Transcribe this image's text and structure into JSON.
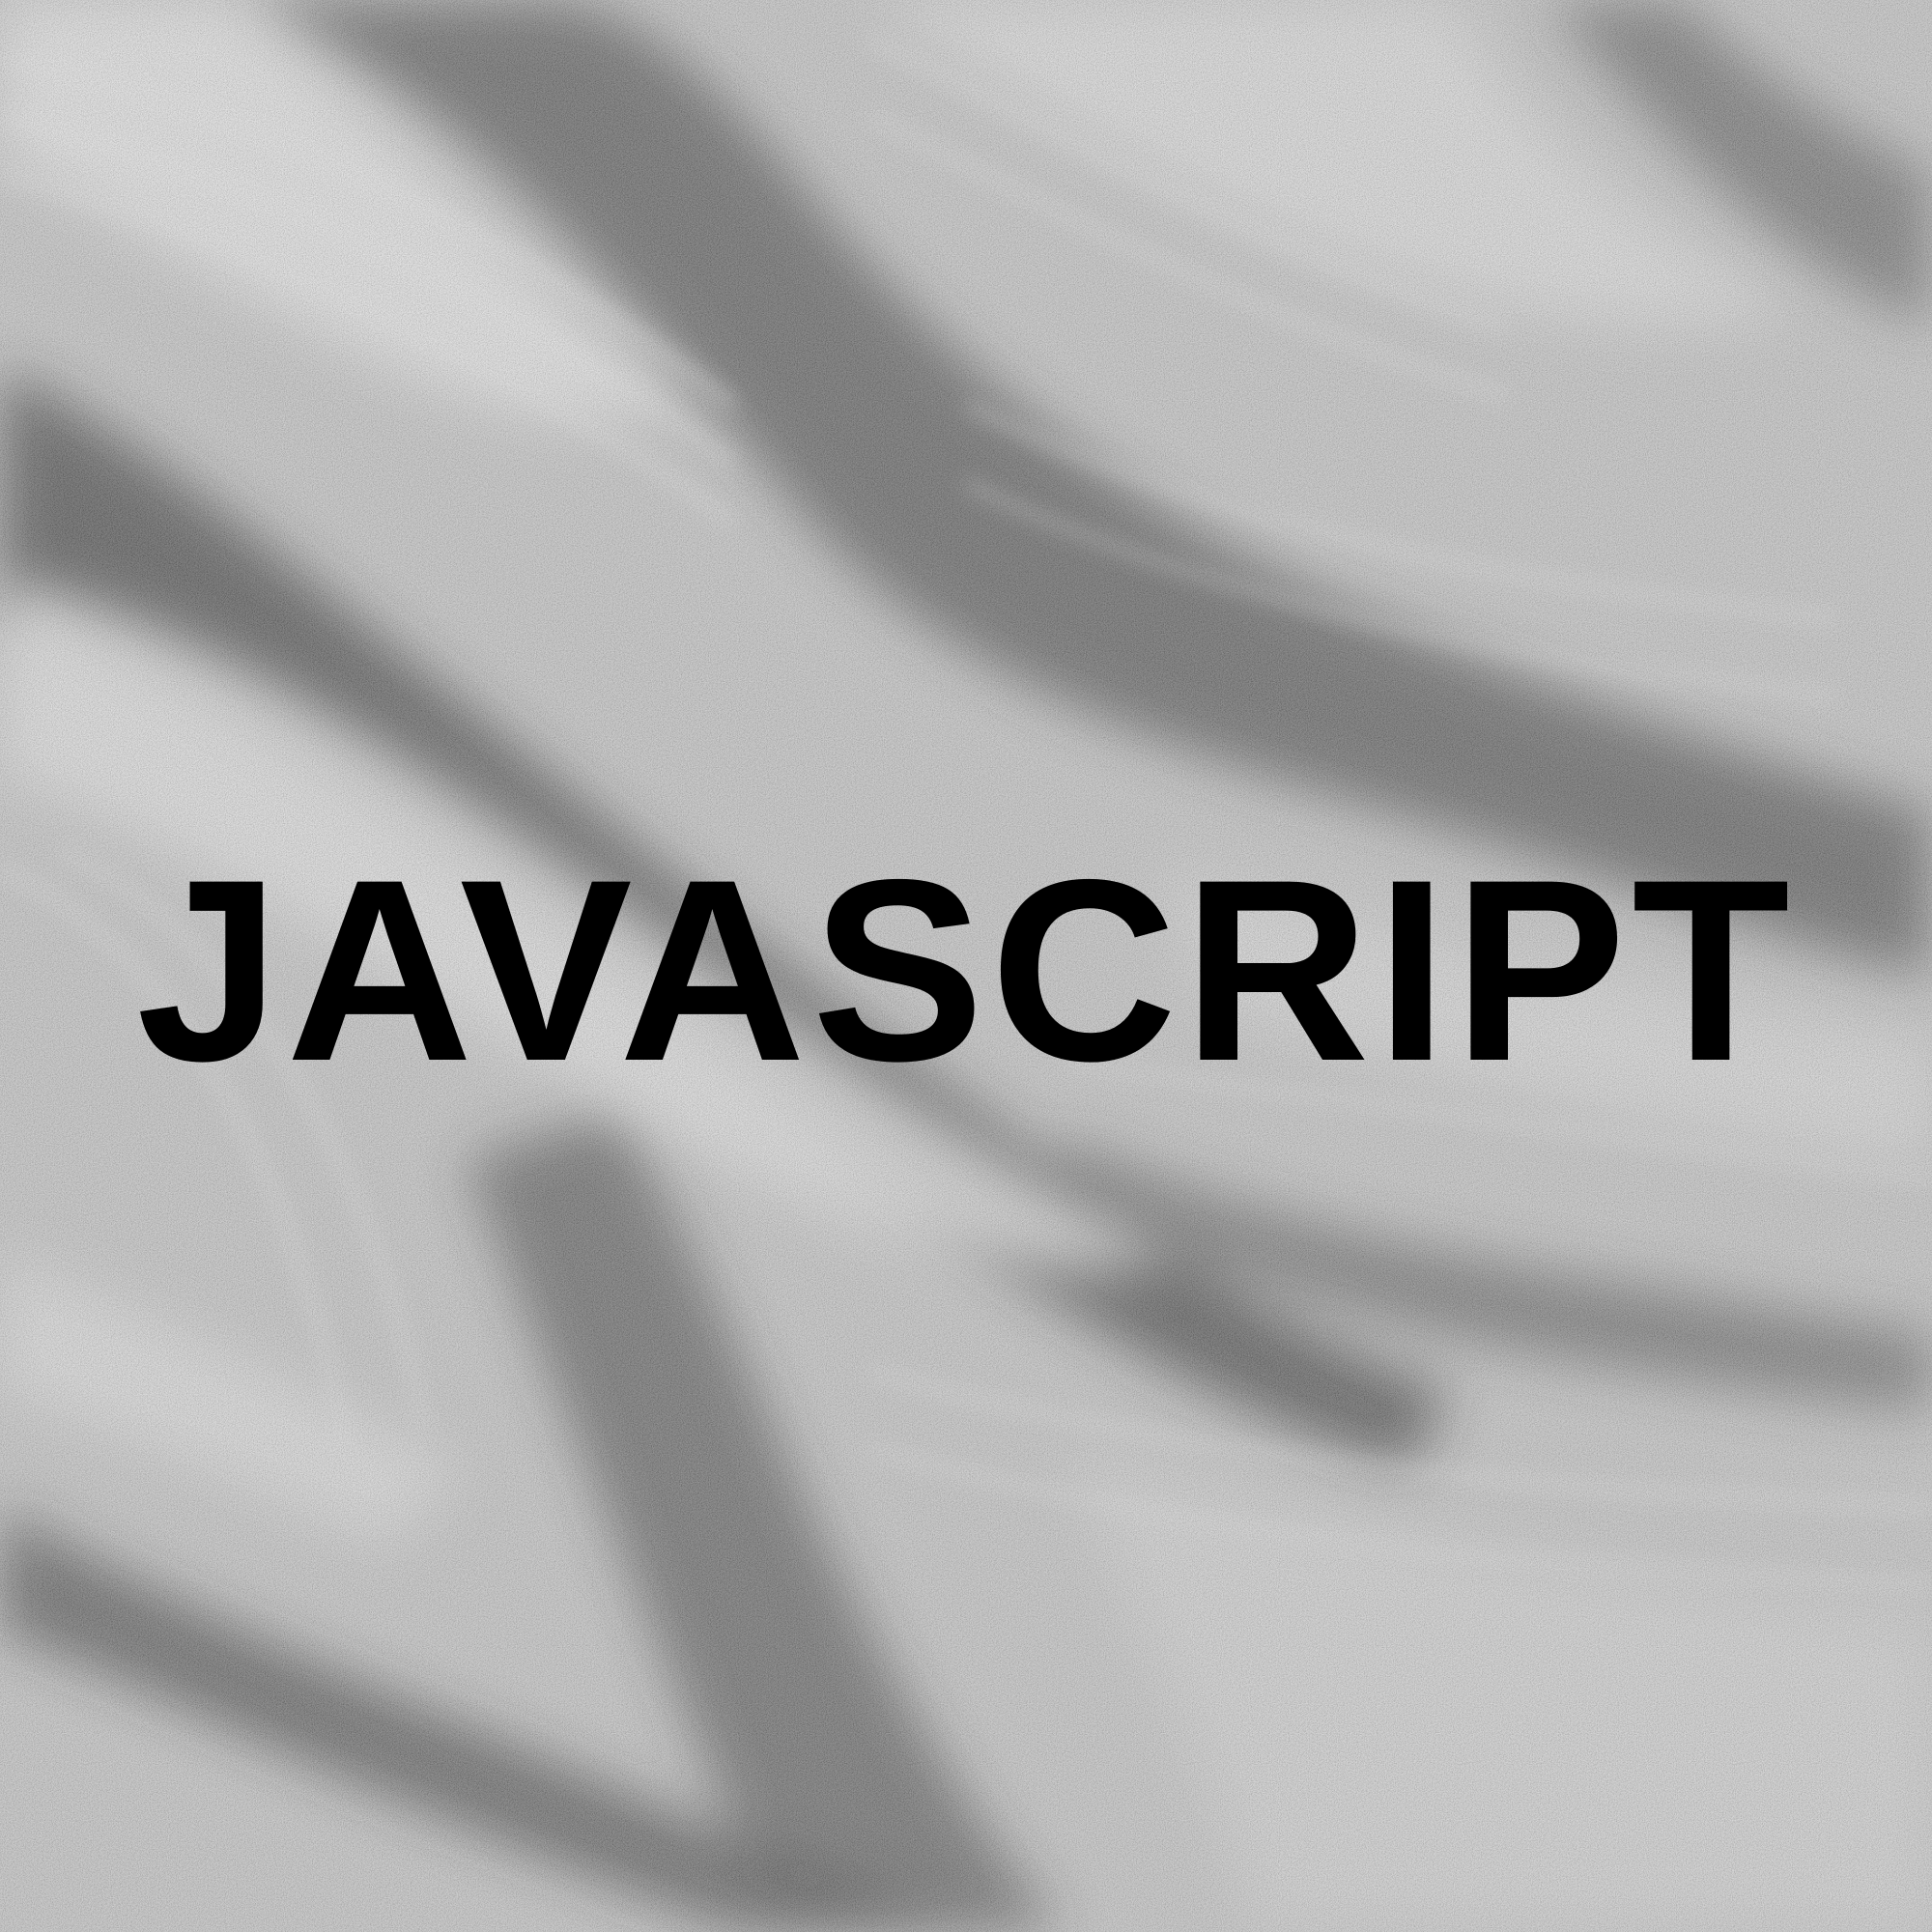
{
  "headline": {
    "text": "JAVASCRIPT",
    "color": "#000000"
  },
  "background": {
    "subject": "rippled-sand-texture",
    "palette": {
      "light": "#e8e8e8",
      "mid": "#b8b8b8",
      "dark": "#1e1e1e"
    }
  }
}
